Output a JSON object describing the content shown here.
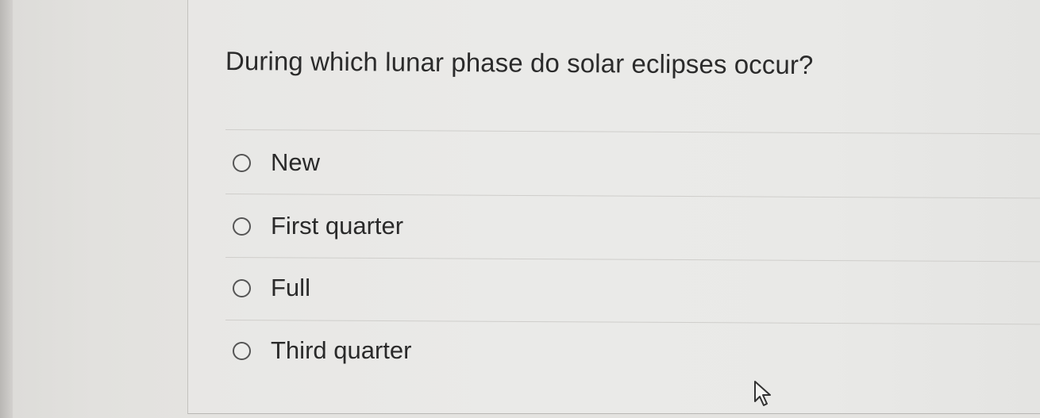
{
  "question": {
    "text": "During which lunar phase do solar eclipses occur?"
  },
  "options": [
    {
      "label": "New",
      "selected": false
    },
    {
      "label": "First quarter",
      "selected": false
    },
    {
      "label": "Full",
      "selected": false
    },
    {
      "label": "Third quarter",
      "selected": false
    }
  ],
  "cursor": {
    "icon": "mouse-pointer-icon"
  }
}
